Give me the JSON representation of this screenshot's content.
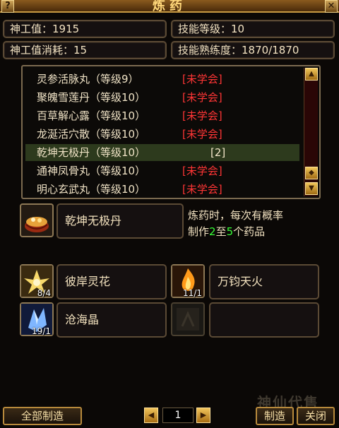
{
  "window": {
    "title": "炼药",
    "help_icon": "help-icon",
    "close_icon": "close-icon"
  },
  "stats": {
    "divine_value": "神工值：1915",
    "skill_level": "技能等级：10",
    "divine_cost": "神工值消耗：15",
    "proficiency": "技能熟练度：1870/1870"
  },
  "recipes": [
    {
      "name": "灵参活脉丸（等级9）",
      "status": "[未学会]",
      "learned": false
    },
    {
      "name": "聚魄雪莲丹（等级10）",
      "status": "[未学会]",
      "learned": false
    },
    {
      "name": "百草解心露（等级10）",
      "status": "[未学会]",
      "learned": false
    },
    {
      "name": "龙涎活穴散（等级10）",
      "status": "[未学会]",
      "learned": false
    },
    {
      "name": "乾坤无极丹（等级10）",
      "status": "[2]",
      "learned": true
    },
    {
      "name": "通神凤骨丸（等级10）",
      "status": "[未学会]",
      "learned": false
    },
    {
      "name": "明心玄武丸（等级10）",
      "status": "[未学会]",
      "learned": false
    }
  ],
  "product": {
    "name": "乾坤无极丹",
    "desc_line1": "炼药时，每次有概率",
    "desc_pre": "制作",
    "desc_min": "2",
    "desc_mid": "至",
    "desc_max": "5",
    "desc_post": "个药品"
  },
  "materials": [
    {
      "name": "彼岸灵花",
      "count": "8/4"
    },
    {
      "name": "万钧天火",
      "count": "11/1"
    },
    {
      "name": "沧海晶",
      "count": "19/1"
    },
    {
      "name": "",
      "count": ""
    }
  ],
  "footer": {
    "make_all": "全部制造",
    "page": "1",
    "make": "制造",
    "close": "关闭",
    "watermark": "神仙代售"
  },
  "colors": {
    "unlearned": "#ff3535",
    "accent_green": "#38ff38",
    "gold": "#ffd77a"
  }
}
